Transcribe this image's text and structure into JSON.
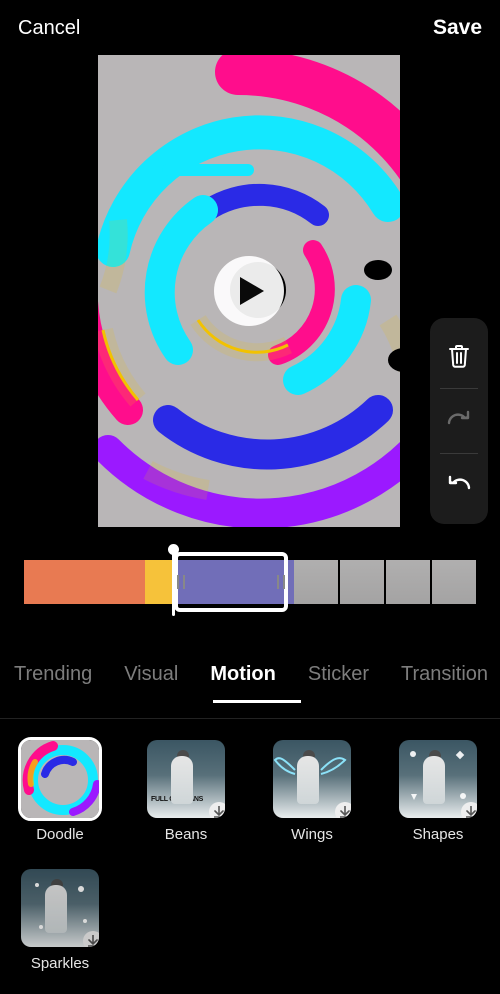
{
  "header": {
    "cancel": "Cancel",
    "save": "Save"
  },
  "toolbar": {
    "delete": "delete",
    "redo": "redo",
    "undo": "undo"
  },
  "tabs": [
    "Trending",
    "Visual",
    "Motion",
    "Sticker",
    "Transition"
  ],
  "active_tab": "Motion",
  "effects": [
    {
      "name": "Doodle",
      "selected": true,
      "download": false
    },
    {
      "name": "Beans",
      "selected": false,
      "download": true
    },
    {
      "name": "Wings",
      "selected": false,
      "download": true
    },
    {
      "name": "Shapes",
      "selected": false,
      "download": true
    },
    {
      "name": "Sparkles",
      "selected": false,
      "download": true
    }
  ],
  "timeline": {
    "segments": [
      "orange",
      "yellow",
      "purple"
    ],
    "selected_segment_index": 2
  }
}
